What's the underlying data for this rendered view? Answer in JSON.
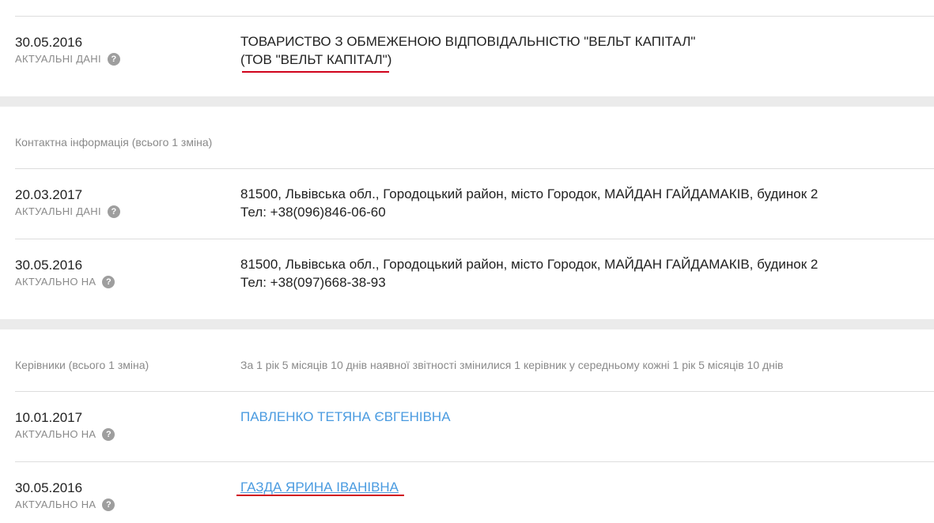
{
  "name_block": {
    "date": "30.05.2016",
    "status": "АКТУАЛЬНІ ДАНІ",
    "full_name": "ТОВАРИСТВО З ОБМЕЖЕНОЮ ВІДПОВІДАЛЬНІСТЮ \"ВЕЛЬТ КАПІТАЛ\"",
    "short_name": "(ТОВ \"ВЕЛЬТ КАПІТАЛ\")"
  },
  "contacts": {
    "title": "Контактна інформація (всього 1 зміна)",
    "entries": [
      {
        "date": "20.03.2017",
        "status": "АКТУАЛЬНІ ДАНІ",
        "address": "81500, Львівська обл., Городоцький район, місто Городок, МАЙДАН ГАЙДАМАКІВ, будинок 2",
        "phone": "Тел: +38(096)846-06-60"
      },
      {
        "date": "30.05.2016",
        "status": "АКТУАЛЬНО НА",
        "address": "81500, Львівська обл., Городоцький район, місто Городок, МАЙДАН ГАЙДАМАКІВ, будинок 2",
        "phone": "Тел: +38(097)668-38-93"
      }
    ]
  },
  "managers": {
    "title": "Керівники (всього 1 зміна)",
    "note": "За 1 рік 5 місяців 10 днів наявної звітності змінилися 1 керівник у середньому кожні 1 рік 5 місяців 10 днів",
    "entries": [
      {
        "date": "10.01.2017",
        "status": "АКТУАЛЬНО НА",
        "name": "ПАВЛЕНКО ТЕТЯНА ЄВГЕНІВНА"
      },
      {
        "date": "30.05.2016",
        "status": "АКТУАЛЬНО НА",
        "name": "ГАЗДА ЯРИНА ІВАНІВНА"
      }
    ]
  },
  "help_icon_glyph": "?",
  "colors": {
    "link": "#4a9be0",
    "annotation": "#d0021b",
    "band": "#ebebeb",
    "muted": "#8a8a8a"
  }
}
